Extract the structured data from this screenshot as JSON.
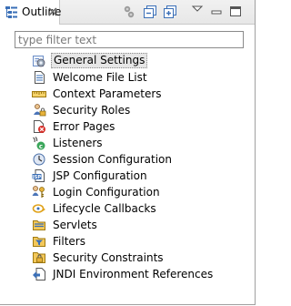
{
  "view": {
    "tab_label": "Outline",
    "filter_placeholder": "type filter text"
  },
  "toolbar": {
    "icons": [
      "sort-icon",
      "collapse-all-icon",
      "expand-all-icon",
      "view-menu-icon",
      "minimize-icon",
      "maximize-icon"
    ]
  },
  "tree": {
    "items": [
      {
        "label": "General Settings",
        "icon": "general-settings-icon",
        "selected": true
      },
      {
        "label": "Welcome File List",
        "icon": "welcome-file-list-icon"
      },
      {
        "label": "Context Parameters",
        "icon": "context-parameters-icon"
      },
      {
        "label": "Security Roles",
        "icon": "security-roles-icon"
      },
      {
        "label": "Error Pages",
        "icon": "error-pages-icon"
      },
      {
        "label": "Listeners",
        "icon": "listeners-icon"
      },
      {
        "label": "Session Configuration",
        "icon": "session-configuration-icon"
      },
      {
        "label": "JSP Configuration",
        "icon": "jsp-configuration-icon"
      },
      {
        "label": "Login Configuration",
        "icon": "login-configuration-icon"
      },
      {
        "label": "Lifecycle Callbacks",
        "icon": "lifecycle-callbacks-icon"
      },
      {
        "label": "Servlets",
        "icon": "servlets-icon"
      },
      {
        "label": "Filters",
        "icon": "filters-icon"
      },
      {
        "label": "Security Constraints",
        "icon": "security-constraints-icon"
      },
      {
        "label": "JNDI Environment References",
        "icon": "jndi-environment-references-icon"
      }
    ]
  },
  "colors": {
    "selection_bg": "#e6e6e6",
    "border": "#a0a0a0",
    "blue_icon": "#2a5caa"
  }
}
